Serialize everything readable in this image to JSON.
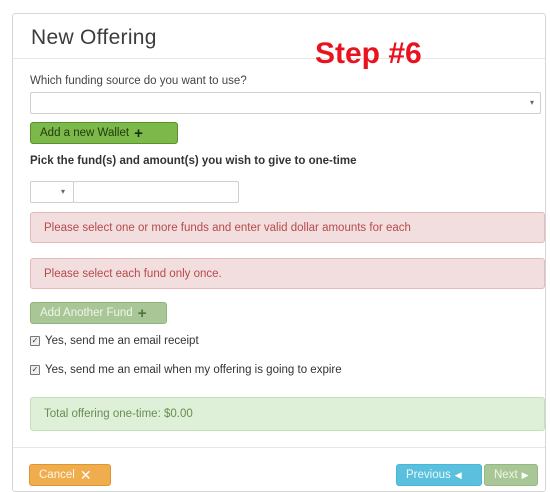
{
  "dialog": {
    "title": "New Offering",
    "annotation": "Step #6"
  },
  "funding": {
    "question": "Which funding source do you want to use?",
    "selected_value": "",
    "add_wallet_label": "Add a new Wallet"
  },
  "funds": {
    "prompt": "Pick the fund(s) and amount(s) you wish to give to one-time",
    "fund_selected": "",
    "amount_value": ""
  },
  "alerts": {
    "error_amounts": "Please select one or more funds and enter valid dollar amounts for each",
    "error_duplicate": "Please select each fund only once.",
    "total": "Total offering one-time: $0.00"
  },
  "add_another_fund_label": "Add Another Fund",
  "options": {
    "email_receipt": {
      "label": "Yes, send me an email receipt",
      "checked": true
    },
    "email_expire": {
      "label": "Yes, send me an email when my offering is going to expire",
      "checked": true
    }
  },
  "footer": {
    "cancel_label": "Cancel",
    "previous_label": "Previous",
    "next_label": "Next"
  },
  "colors": {
    "annotation": "#e8131e",
    "add_wallet_button": "#7cb84a",
    "error_alert_bg": "#f2dede",
    "success_alert_bg": "#dff0d8",
    "cancel_button": "#f0ad4e",
    "previous_button": "#5bc0de",
    "next_button_disabled": "#a9c796"
  },
  "icons": {
    "plus": "plus-icon",
    "close": "close-icon",
    "chevron_left": "chevron-left-icon",
    "chevron_right": "chevron-right-icon",
    "caret_down": "caret-down-icon",
    "checkbox": "checkbox-icon"
  }
}
